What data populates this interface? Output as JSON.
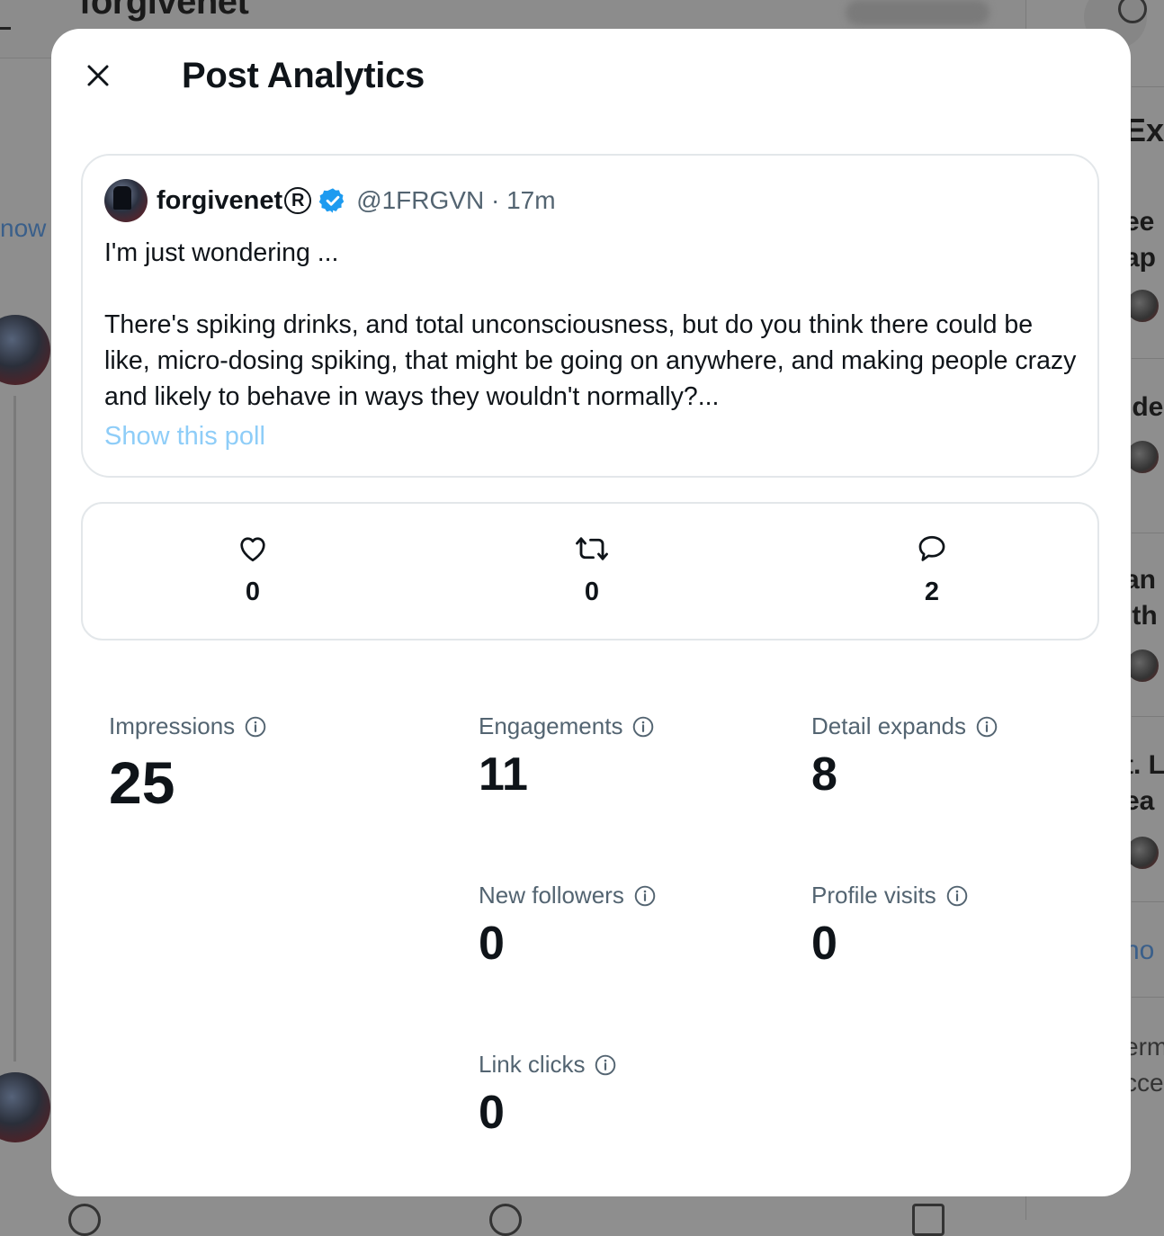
{
  "background": {
    "profile_title": "forgivenet",
    "left_link": "now",
    "right_headings": [
      "Exp",
      "ee",
      "ap",
      "ide",
      "an",
      "ith",
      "t. L",
      "ea",
      "ho",
      "erm",
      "cce"
    ]
  },
  "modal": {
    "title": "Post Analytics",
    "close_icon": "close-icon"
  },
  "post": {
    "author_name": "forgivenet",
    "registered_mark": "R",
    "verified_icon": "verified-badge-icon",
    "handle_time": "@1FRGVN · 17m",
    "line1": "I'm just wondering ...",
    "paragraph2": "There's spiking drinks, and total unconsciousness, but do you think there could be like, micro-dosing spiking, that might be going on anywhere, and making people crazy and likely to behave in ways they wouldn't normally?...",
    "show_poll": "Show this poll"
  },
  "engagement": {
    "likes": "0",
    "reposts": "0",
    "replies": "2"
  },
  "metrics": {
    "impressions": {
      "label": "Impressions",
      "value": "25"
    },
    "engagements": {
      "label": "Engagements",
      "value": "11"
    },
    "detail_expands": {
      "label": "Detail expands",
      "value": "8"
    },
    "new_followers": {
      "label": "New followers",
      "value": "0"
    },
    "profile_visits": {
      "label": "Profile visits",
      "value": "0"
    },
    "link_clicks": {
      "label": "Link clicks",
      "value": "0"
    }
  },
  "colors": {
    "text": "#0f1419",
    "muted": "#536471",
    "link_disabled": "#8ecdf8",
    "verified": "#1d9bf0",
    "border": "#e3e7ea"
  }
}
